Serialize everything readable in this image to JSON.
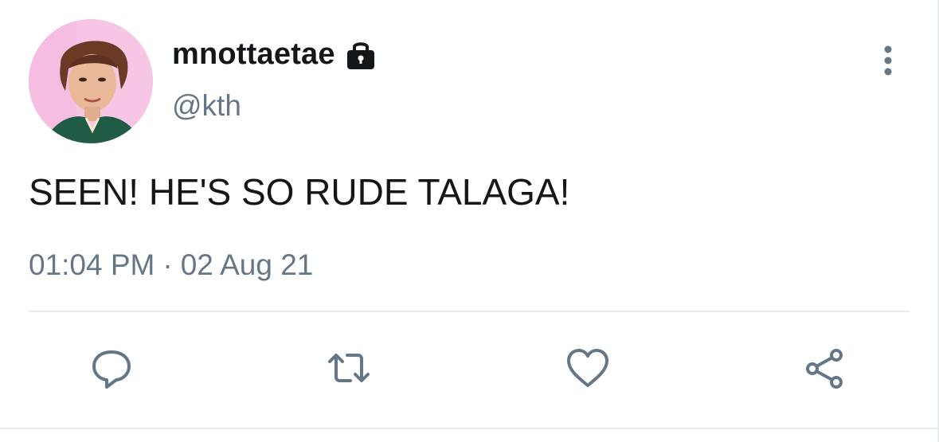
{
  "user": {
    "display_name": "mnottaetae",
    "handle": "@kth",
    "protected_icon": "lock-icon",
    "avatar_icon": "avatar-photo"
  },
  "tweet": {
    "text": "SEEN! HE'S SO RUDE TALAGA!",
    "time": "01:04 PM",
    "separator": "·",
    "date": "02 Aug 21"
  },
  "menu": {
    "icon": "more-vertical-icon"
  },
  "actions": [
    {
      "name": "reply",
      "icon": "reply-icon"
    },
    {
      "name": "retweet",
      "icon": "retweet-icon"
    },
    {
      "name": "like",
      "icon": "heart-icon"
    },
    {
      "name": "share",
      "icon": "share-icon"
    }
  ],
  "colors": {
    "text_primary": "#14171a",
    "text_secondary": "#657786",
    "divider": "#e6ecf0",
    "icon": "#657786"
  }
}
